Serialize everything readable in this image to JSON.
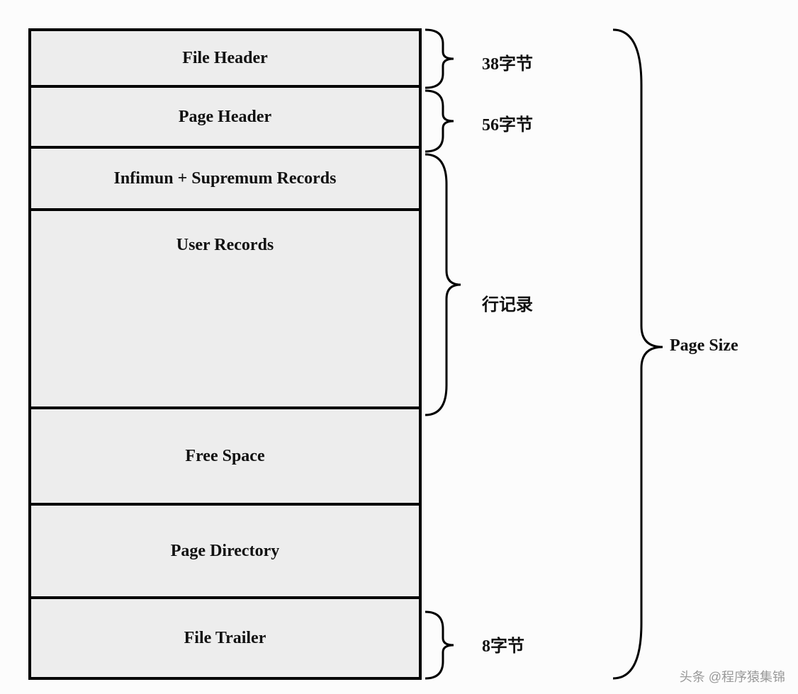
{
  "sections": {
    "file_header": "File Header",
    "page_header": "Page Header",
    "infimun": "Infimun + Supremum Records",
    "user_records": "User Records",
    "free_space": "Free Space",
    "page_directory": "Page Directory",
    "file_trailer": "File Trailer"
  },
  "annotations": {
    "file_header_size": "38字节",
    "page_header_size": "56字节",
    "row_records": "行记录",
    "file_trailer_size": "8字节",
    "page_size": "Page Size"
  },
  "watermark": "头条 @程序猿集锦"
}
